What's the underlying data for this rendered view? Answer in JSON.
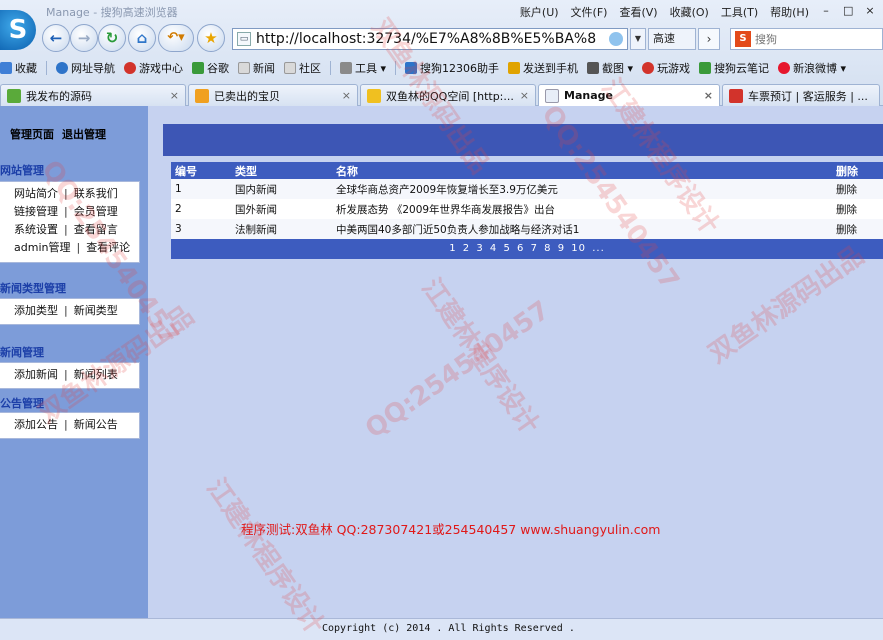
{
  "browser": {
    "window_title": "Manage - 搜狗高速浏览器",
    "logo_glyph": "S",
    "menu": [
      "账户(U)",
      "文件(F)",
      "查看(V)",
      "收藏(O)",
      "工具(T)",
      "帮助(H)"
    ],
    "address": "http://localhost:32734/%E7%A8%8B%E5%BA%8F/Admir",
    "speed_label": "高速",
    "search_placeholder": "搜狗",
    "bookmarks": [
      {
        "label": "收藏",
        "color": "#3f7fd6"
      },
      {
        "label": "网址导航",
        "color": "#2e74c9"
      },
      {
        "label": "游戏中心",
        "color": "#d2332b"
      },
      {
        "label": "谷歌",
        "color": "#3a9a3a"
      },
      {
        "label": "新闻",
        "color": "#d9d9d9"
      },
      {
        "label": "社区",
        "color": "#d9d9d9"
      },
      {
        "label": "工具",
        "color": "#8a8a8a"
      },
      {
        "label": "搜狗12306助手",
        "color": "#2e74c9"
      },
      {
        "label": "发送到手机",
        "color": "#e0a300"
      },
      {
        "label": "截图",
        "color": "#555555"
      },
      {
        "label": "玩游戏",
        "color": "#d2332b"
      },
      {
        "label": "搜狗云笔记",
        "color": "#3a9a3a"
      },
      {
        "label": "新浪微博",
        "color": "#e6162d"
      }
    ],
    "tabs": [
      {
        "label": "我发布的源码",
        "color": "#5aaa3a"
      },
      {
        "label": "已卖出的宝贝",
        "color": "#f0a020"
      },
      {
        "label": "双鱼林的QQ空间 [http:...",
        "color": "#f0c020"
      },
      {
        "label": "Manage",
        "color": "#e8eef8"
      },
      {
        "label": "车票预订 | 客运服务 | ...",
        "color": "#d2332b"
      }
    ]
  },
  "sidebar": {
    "top_links": [
      "管理页面",
      "退出管理"
    ],
    "sections": [
      {
        "title": "网站管理",
        "rows": [
          [
            "网站简介",
            "联系我们"
          ],
          [
            "链接管理",
            "会员管理"
          ],
          [
            "系统设置",
            "查看留言"
          ],
          [
            "admin管理",
            "查看评论"
          ]
        ]
      },
      {
        "title": "新闻类型管理",
        "rows": [
          [
            "添加类型",
            "新闻类型"
          ]
        ]
      },
      {
        "title": "新闻管理",
        "rows": [
          [
            "添加新闻",
            "新闻列表"
          ]
        ]
      },
      {
        "title": "公告管理",
        "rows": [
          [
            "添加公告",
            "新闻公告"
          ]
        ]
      }
    ]
  },
  "table": {
    "headers": [
      "编号",
      "类型",
      "名称",
      "删除"
    ],
    "rows": [
      {
        "id": "1",
        "type": "国内新闻",
        "name": "全球华商总资产2009年恢复增长至3.9万亿美元",
        "action": "删除"
      },
      {
        "id": "2",
        "type": "国外新闻",
        "name": "析发展态势 《2009年世界华商发展报告》出台",
        "action": "删除"
      },
      {
        "id": "3",
        "type": "法制新闻",
        "name": "中美两国40多部门近50负责人参加战略与经济对话1",
        "action": "删除"
      }
    ],
    "pages": [
      "1",
      "2",
      "3",
      "4",
      "5",
      "6",
      "7",
      "8",
      "9",
      "10",
      "..."
    ]
  },
  "test_note": "程序测试:双鱼林 QQ:287307421或254540457 www.shuangyulin.com",
  "footer": {
    "copyright": "Copyright (c) 2014  .  All Rights Reserved ."
  },
  "watermarks": [
    "双鱼林源码出品",
    "QQ:254540457",
    "江建林程序设计"
  ],
  "colors": {
    "sidebar": "#7d9cd9",
    "content_bg": "#c6d2f0",
    "header_bar": "#3d56b5",
    "watermark": "#e24646"
  }
}
